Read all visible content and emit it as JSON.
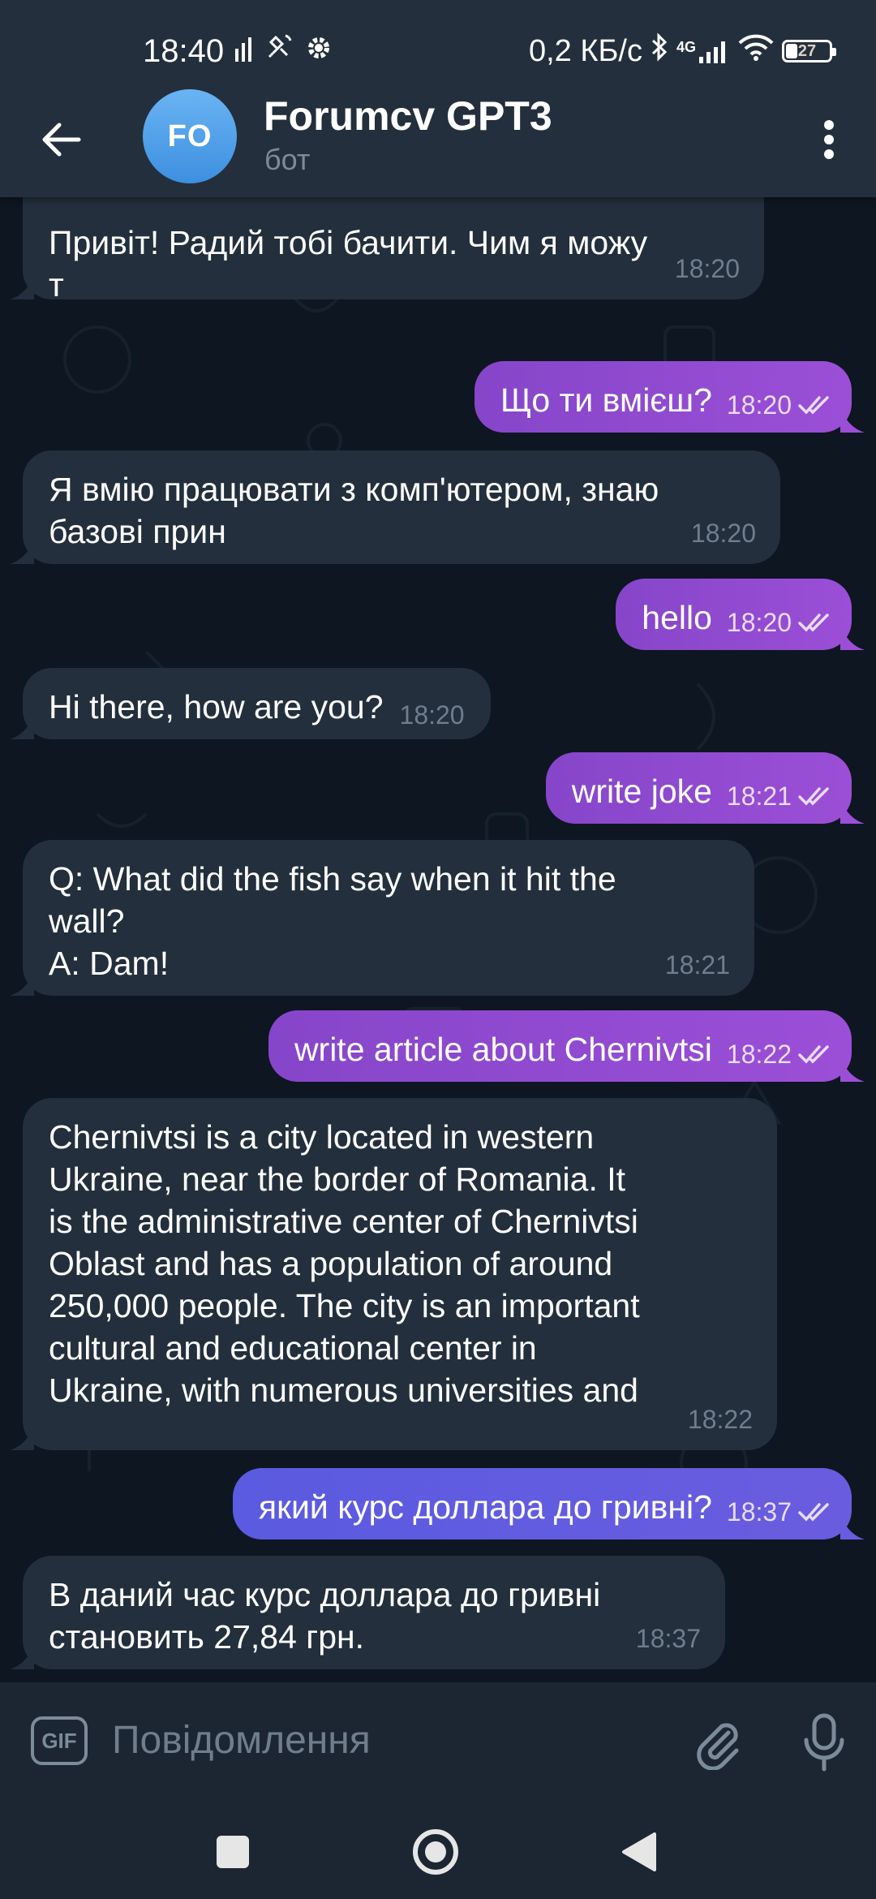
{
  "status_bar": {
    "time": "18:40",
    "network_speed": "0,2 КБ/с",
    "network_type": "4G",
    "battery": "27",
    "battery_level": 0.27
  },
  "header": {
    "avatar_initials": "FO",
    "title": "Forumcv GPT3",
    "subtitle": "бот",
    "icons": [
      "back-arrow-icon",
      "more-vert-icon"
    ]
  },
  "messages": [
    {
      "direction": "in",
      "text": "Привіт! Радий тобі бачити. Чим я можу\nт",
      "time": "18:20"
    },
    {
      "direction": "out",
      "text": "Що ти вмієш?",
      "time": "18:20"
    },
    {
      "direction": "in",
      "text": "Я вмію працювати з комп'ютером, знаю\nбазові прин",
      "time": "18:20"
    },
    {
      "direction": "out",
      "text": "hello",
      "time": "18:20"
    },
    {
      "direction": "in",
      "text": "Hi there, how are you?",
      "time": "18:20"
    },
    {
      "direction": "out",
      "text": "write joke",
      "time": "18:21"
    },
    {
      "direction": "in",
      "text": "Q: What did the fish say when it hit the\nwall?\nA: Dam!",
      "time": "18:21"
    },
    {
      "direction": "out",
      "text": "write article about Chernivtsi",
      "time": "18:22"
    },
    {
      "direction": "in",
      "text": "Chernivtsi is a city located in western\nUkraine, near the border of Romania. It\nis the administrative center of Chernivtsi\nOblast and has a population of around\n250,000 people. The city is an important\ncultural and educational center in\nUkraine, with numerous universities and",
      "time": "18:22"
    },
    {
      "direction": "out",
      "text": "який курс доллара до гривні?",
      "time": "18:37"
    },
    {
      "direction": "in",
      "text": "В даний час курс доллара до гривні\nстановить 27,84 грн.",
      "time": "18:37"
    }
  ],
  "composer": {
    "gif_label": "GIF",
    "placeholder": "Повідомлення",
    "icons": [
      "attach-icon",
      "microphone-icon"
    ]
  },
  "colors": {
    "header_bg": "#242f3d",
    "chat_bg": "#0e1621",
    "incoming_bubble": "#232f3c",
    "outgoing_bubble": "#9b4fd6",
    "outgoing_bubble_latest": "#6a5cdf"
  }
}
